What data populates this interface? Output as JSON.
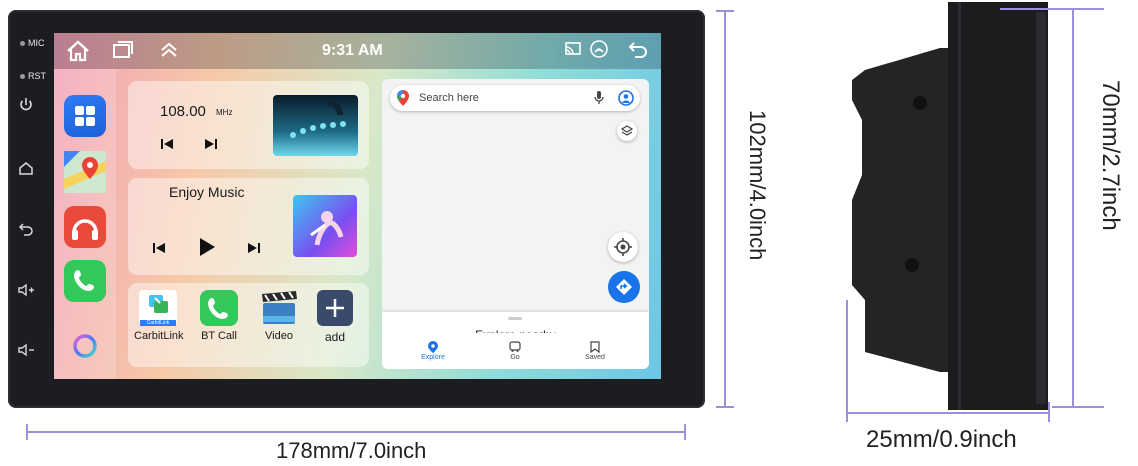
{
  "device": {
    "side_labels": {
      "mic": "MIC",
      "rst": "RST"
    },
    "side_icons": [
      "power-icon",
      "home-icon",
      "back-icon",
      "volume-up-icon",
      "volume-down-icon"
    ]
  },
  "status_bar": {
    "time": "9:31 AM"
  },
  "radio": {
    "frequency": "108.00",
    "unit": "MHz"
  },
  "music": {
    "title": "Enjoy Music"
  },
  "shortcuts": [
    {
      "label": "CarbitLink",
      "badge": "CarbitLink"
    },
    {
      "label": "BT Call"
    },
    {
      "label": "Video"
    },
    {
      "label": "add"
    }
  ],
  "map": {
    "search_placeholder": "Search here",
    "explore_title": "Explore nearby",
    "tabs": [
      {
        "label": "Explore"
      },
      {
        "label": "Go"
      },
      {
        "label": "Saved"
      }
    ],
    "accent": "#1a73e8"
  },
  "dimensions": {
    "width": "178mm/7.0inch",
    "height": "102mm/4.0inch",
    "depth": "25mm/0.9inch",
    "side_height": "70mm/2.7inch"
  }
}
